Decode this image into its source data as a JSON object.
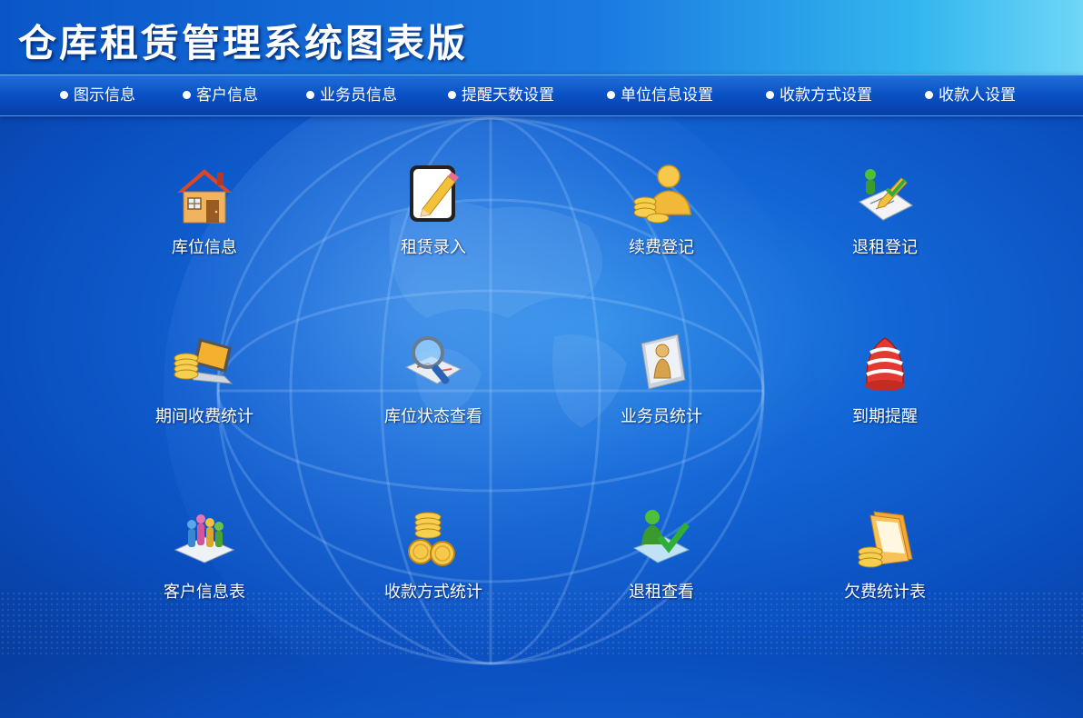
{
  "header": {
    "title": "仓库租赁管理系统图表版"
  },
  "nav": [
    {
      "label": "图示信息"
    },
    {
      "label": "客户信息"
    },
    {
      "label": "业务员信息"
    },
    {
      "label": "提醒天数设置"
    },
    {
      "label": "单位信息设置"
    },
    {
      "label": "收款方式设置"
    },
    {
      "label": "收款人设置"
    }
  ],
  "tiles": [
    {
      "label": "库位信息",
      "icon": "house-icon"
    },
    {
      "label": "租赁录入",
      "icon": "pencil-note-icon"
    },
    {
      "label": "续费登记",
      "icon": "person-coins-icon"
    },
    {
      "label": "退租登记",
      "icon": "checklist-person-icon"
    },
    {
      "label": "期间收费统计",
      "icon": "laptop-coins-icon"
    },
    {
      "label": "库位状态查看",
      "icon": "magnifier-map-icon"
    },
    {
      "label": "业务员统计",
      "icon": "salesman-icon"
    },
    {
      "label": "到期提醒",
      "icon": "alarm-bell-icon"
    },
    {
      "label": "客户信息表",
      "icon": "people-chart-icon"
    },
    {
      "label": "收款方式统计",
      "icon": "coin-stack-icon"
    },
    {
      "label": "退租查看",
      "icon": "person-check-icon"
    },
    {
      "label": "欠费统计表",
      "icon": "folder-coins-icon"
    }
  ],
  "colors": {
    "background": "#0a4fc0",
    "header_end": "#6fd6f7",
    "text": "#ffffff"
  }
}
